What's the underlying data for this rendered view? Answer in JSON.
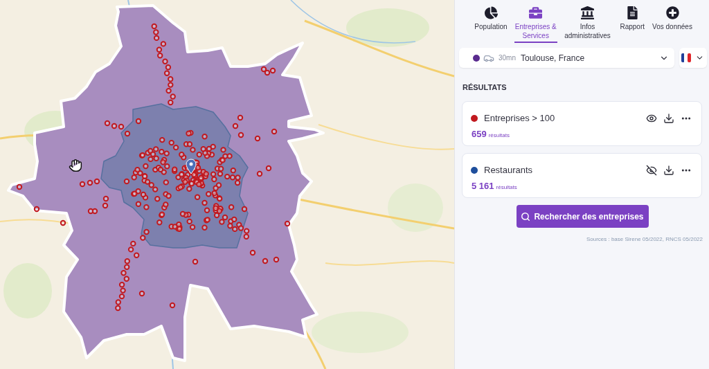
{
  "tabs": [
    {
      "label": "Population",
      "selected": false
    },
    {
      "label": "Entreprises & Services",
      "selected": true
    },
    {
      "label": "Infos administratives",
      "selected": false
    },
    {
      "label": "Rapport",
      "selected": false
    },
    {
      "label": "Vos données",
      "selected": false
    }
  ],
  "location_select": {
    "color": "#5a2b8f",
    "travel_time": "30mn",
    "value": "Toulouse, France"
  },
  "results": {
    "heading": "RÉSULTATS",
    "items": [
      {
        "title": "Entreprises > 100",
        "color": "#c1191f",
        "count": "659",
        "unit": "résultats",
        "visible": true
      },
      {
        "title": "Restaurants",
        "color": "#1f4f9c",
        "count": "5 161",
        "unit": "résultats",
        "visible": false
      }
    ]
  },
  "search_button": {
    "label": "Rechercher des entreprises"
  },
  "sources": "Sources : base Sirene 05/2022, RNCS 05/2022"
}
